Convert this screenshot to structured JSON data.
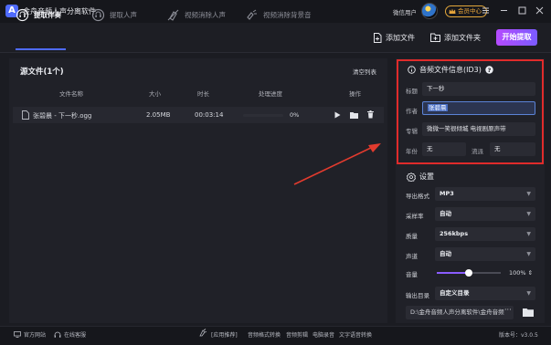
{
  "titlebar": {
    "logo": "A",
    "title": "金舟音频人声分离软件",
    "user": "微信用户",
    "vip_label": "会员中心",
    "icons": [
      "app-logo",
      "avatar",
      "crown-icon",
      "menu-icon",
      "minimize-icon",
      "maximize-icon",
      "close-icon"
    ]
  },
  "tabs": [
    {
      "label": "提取伴奏",
      "icon": "accompaniment-icon",
      "active": true
    },
    {
      "label": "提取人声",
      "icon": "vocal-icon",
      "active": false
    },
    {
      "label": "视频消除人声",
      "icon": "video-vocal-remove-icon",
      "active": false
    },
    {
      "label": "视频消除背景音",
      "icon": "video-bg-remove-icon",
      "active": false
    }
  ],
  "toolbar": {
    "add_file": "添加文件",
    "add_folder": "添加文件夹",
    "start": "开始提取"
  },
  "files": {
    "title": "源文件(1个)",
    "clear": "清空列表",
    "columns": [
      "文件名称",
      "大小",
      "时长",
      "处理进度",
      "操作"
    ],
    "rows": [
      {
        "name": "张碧晨 - 下一秒.ogg",
        "size": "2.05MB",
        "duration": "00:03:14",
        "progress_text": "0%",
        "progress": 0
      }
    ]
  },
  "id3": {
    "title": "音频文件信息(ID3)",
    "title_label": "标题",
    "title_value": "下一秒",
    "artist_label": "作者",
    "artist_value": "张碧晨",
    "album_label": "专辑",
    "album_value": "微微一笑很倾城 电视剧原声带",
    "year_label": "年份",
    "year_value": "无",
    "genre_label": "流派",
    "genre_value": "无"
  },
  "settings": {
    "title": "设置",
    "format_label": "导出格式",
    "format_value": "MP3",
    "samplerate_label": "采样率",
    "samplerate_value": "自动",
    "quality_label": "质量",
    "quality_value": "256kbps",
    "channel_label": "声道",
    "channel_value": "自动",
    "volume_label": "音量",
    "volume_value": "100%",
    "volume": 0.5,
    "outdir_label": "输出目录",
    "outdir_value": "自定义目录",
    "path_value": "D:\\金舟音频人声分离软件\\金舟音频",
    "path_more": "···"
  },
  "statusbar": {
    "website": "官方网站",
    "support": "在线客服",
    "apps_label": "[应用推荐]",
    "apps": [
      "音频格式转换",
      "音频剪辑",
      "电脑录音",
      "文字语音转换"
    ],
    "version": "版本号：v3.0.5"
  },
  "colors": {
    "accent": "#4f6bff",
    "start_gradient": [
      "#b54bff",
      "#7b5bff"
    ],
    "highlight_box": "#e02b2b",
    "arrow": "#e23b2e"
  }
}
